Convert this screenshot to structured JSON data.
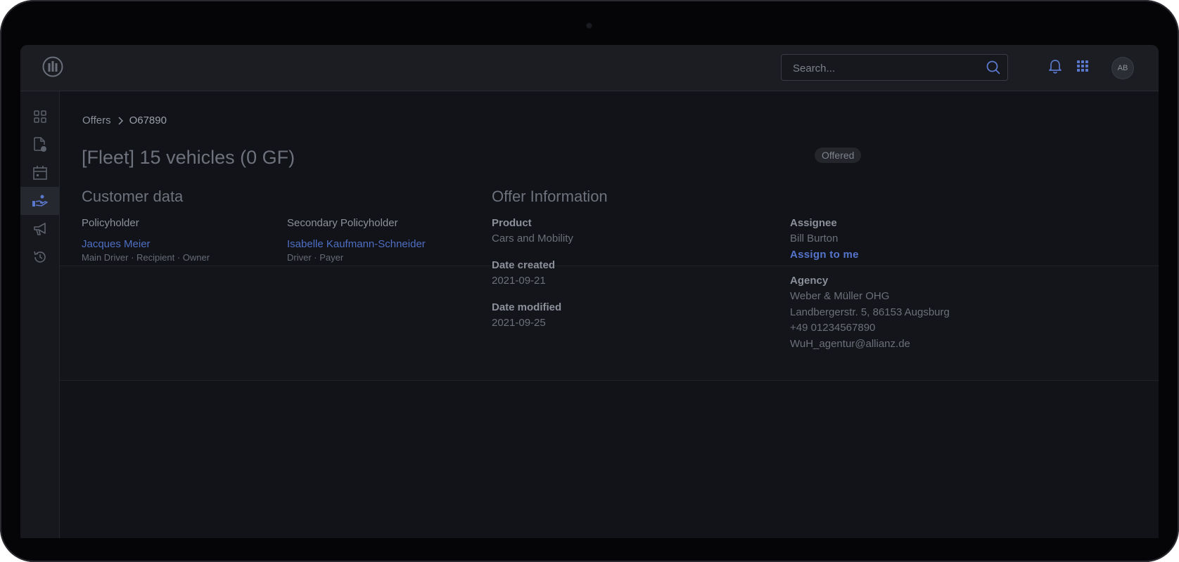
{
  "search": {
    "placeholder": "Search..."
  },
  "user": {
    "initials": "AB"
  },
  "breadcrumb": {
    "parent": "Offers",
    "current": "O67890"
  },
  "page": {
    "title": "[Fleet] 15 vehicles (0 GF)",
    "status": "Offered"
  },
  "customer": {
    "section_title": "Customer data",
    "policyholder": {
      "label": "Policyholder",
      "name": "Jacques Meier",
      "roles": "Main Driver  ·  Recipient  ·  Owner"
    },
    "secondary": {
      "label": "Secondary Policyholder",
      "name": "Isabelle Kaufmann-Schneider",
      "roles": "Driver  ·  Payer"
    }
  },
  "offer": {
    "section_title": "Offer Information",
    "product_label": "Product",
    "product": "Cars and Mobility",
    "created_label": "Date created",
    "created": "2021-09-21",
    "modified_label": "Date modified",
    "modified": "2021-09-25",
    "assignee_label": "Assignee",
    "assignee": "Bill Burton",
    "assign_link": "Assign to me",
    "agency_label": "Agency",
    "agency_name": "Weber & Müller OHG",
    "agency_address": "Landbergerstr. 5, 86153 Augsburg",
    "agency_phone": "+49 01234567890",
    "agency_email": "WuH_agentur@allianz.de"
  },
  "colors": {
    "accent": "#4f6fc4",
    "background": "#121318",
    "topbar": "#1c1d23"
  },
  "icons": {
    "logo": "allianz-logo",
    "sidebar": [
      "dashboard-icon",
      "document-check-icon",
      "calendar-icon",
      "hand-offer-icon",
      "megaphone-icon",
      "history-icon"
    ],
    "topbar": [
      "search-icon",
      "bell-icon",
      "apps-grid-icon"
    ]
  }
}
